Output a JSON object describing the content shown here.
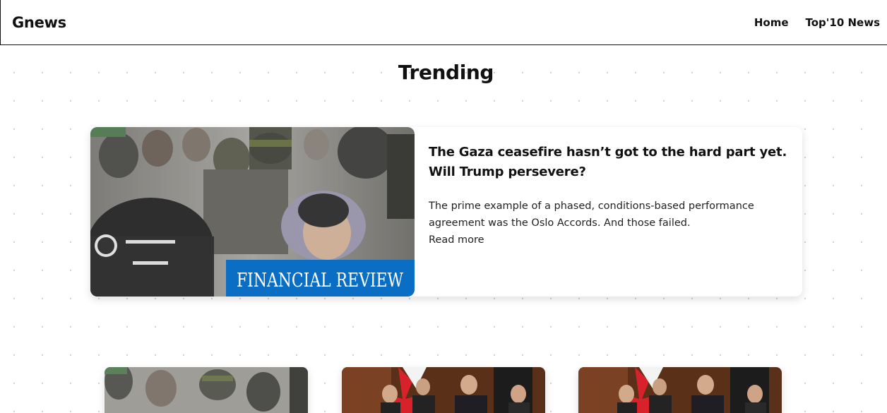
{
  "navbar": {
    "brand": "Gnews",
    "links": [
      "Home",
      "Top'10 News"
    ]
  },
  "section_title": "Trending",
  "featured": {
    "title": "The Gaza ceasefire hasn’t got to the hard part yet. Will Trump persevere?",
    "description": "The prime example of a phased, conditions-based performance agreement was the Oslo Accords. And those failed.",
    "read_more": "Read more",
    "image_watermark": "FINANCIAL REVIEW"
  },
  "cards": [
    {
      "image": "gaza-crowd-photo"
    },
    {
      "image": "parliament-signing-photo"
    },
    {
      "image": "parliament-signing-photo"
    }
  ],
  "colors": {
    "watermark_bg": "#0a6fc4",
    "text": "#111111",
    "background": "#ffffff"
  }
}
